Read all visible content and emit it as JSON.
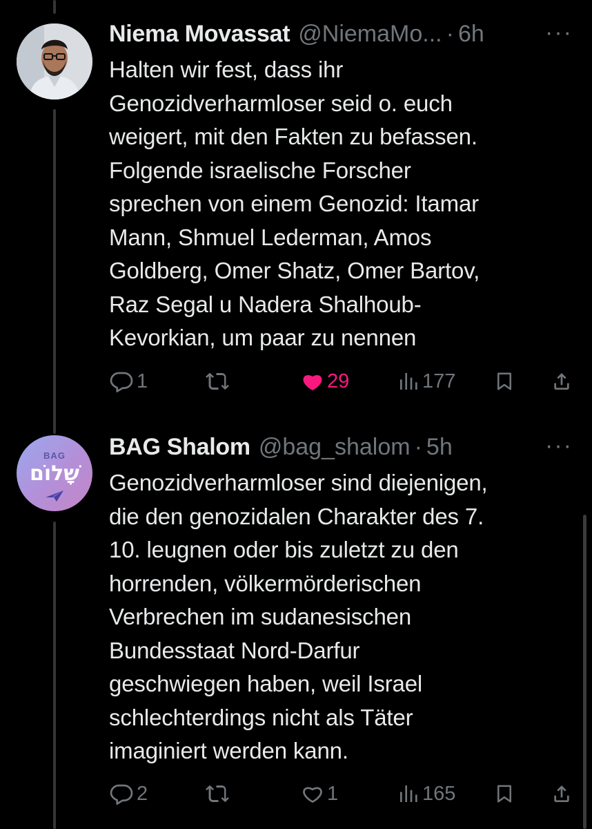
{
  "tweets": [
    {
      "name": "Niema Movassat",
      "handle": "@NiemaMo...",
      "dot": "·",
      "time": "6h",
      "more": "···",
      "lines": [
        "Halten wir fest, dass ihr",
        "Genozidverharmloser seid o. euch",
        "weigert, mit den Fakten zu befassen.",
        "Folgende israelische Forscher",
        "sprechen von einem Genozid: Itamar",
        "Mann, Shmuel Lederman, Amos",
        "Goldberg, Omer Shatz, Omer Bartov,",
        "Raz Segal u Nadera Shalhoub-",
        "Kevorkian, um paar zu nennen"
      ],
      "replies": "1",
      "retweets": "",
      "likes": "29",
      "views": "177",
      "liked": true
    },
    {
      "name": "BAG Shalom",
      "handle": "@bag_shalom",
      "dot": "·",
      "time": "5h",
      "more": "···",
      "avatar_top": "BAG",
      "avatar_logo": "שָׁלוֹם",
      "lines": [
        "Genozidverharmloser sind diejenigen,",
        "die den genozidalen Charakter des 7.",
        "10. leugnen oder bis zuletzt zu den",
        "horrenden, völkermörderischen",
        "Verbrechen im sudanesischen",
        "Bundesstaat Nord-Darfur",
        "geschwiegen haben, weil Israel",
        "schlechterdings nicht als Täter",
        "imaginiert werden kann."
      ],
      "replies": "2",
      "retweets": "",
      "likes": "1",
      "views": "165",
      "liked": false
    }
  ],
  "colors": {
    "background": "#000000",
    "text": "#e7e9ea",
    "secondary": "#71767b",
    "like": "#f91880",
    "thread_line": "#333639"
  },
  "icons": [
    "reply-icon",
    "retweet-icon",
    "like-icon",
    "views-icon",
    "bookmark-icon",
    "share-icon",
    "more-icon"
  ]
}
